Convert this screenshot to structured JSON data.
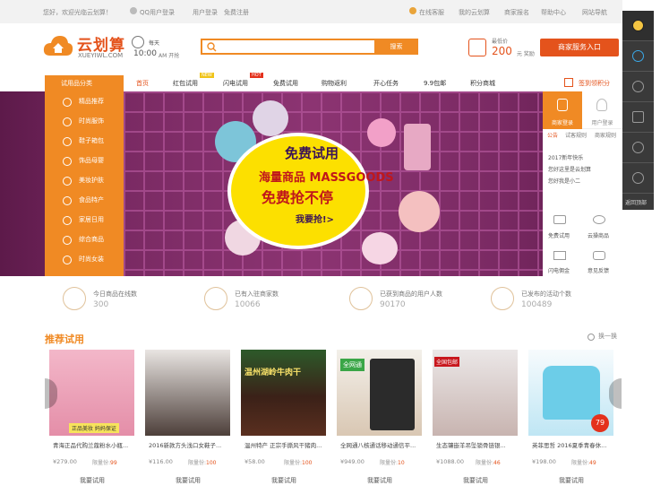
{
  "topbar": {
    "welcome": "您好，欢迎光临云划算！",
    "qq_login": "QQ用户登录",
    "login": "用户登录",
    "register": "免费注册",
    "online_service": "在线客服",
    "my_account": "我的云划算",
    "merchant_register": "商家报名",
    "help_center": "帮助中心",
    "site_nav": "网站导航"
  },
  "header": {
    "logo_text": "云划算",
    "logo_sub": "XUEYIWL.COM",
    "clock_label": "每天",
    "clock_time": "10:00",
    "clock_suffix": "AM 开抢",
    "search_placeholder": "",
    "search_button": "搜索",
    "hot_label": "最低价",
    "hot_value": "200",
    "hot_suffix": "元 奖励",
    "merchant_button": "商家服务入口"
  },
  "nav": {
    "category_head": "试用品分类",
    "items": [
      "首页",
      "红包试用",
      "闪电试用",
      "免费试用",
      "购物返利",
      "开心任务",
      "9.9包邮",
      "积分商城"
    ],
    "badge_new": "NEW",
    "badge_hot": "HOT",
    "signin": "签到领积分"
  },
  "categories": [
    "精品推荐",
    "时尚服饰",
    "鞋子箱包",
    "饰品母婴",
    "美妆护肤",
    "食品特产",
    "家居日用",
    "综合商品",
    "时尚女装"
  ],
  "banner": {
    "line1": "免费试用",
    "line2": "海量商品 MASSGOODS",
    "line3": "免费抢不停",
    "cta": "我要抢!>"
  },
  "right_panel": {
    "tab_merchant": "商家登录",
    "tab_user": "用户登录",
    "subtabs": [
      "公告",
      "试客规则",
      "商家规则"
    ],
    "news": [
      "2017新年快乐",
      "您好这里是云划算",
      "您好我是小二"
    ],
    "services": [
      "免费试用",
      "云操商品",
      "闪电佣金",
      "意见反馈"
    ]
  },
  "stats": [
    {
      "label": "今日商品在线数",
      "value": "300"
    },
    {
      "label": "已有入驻商家数",
      "value": "10066"
    },
    {
      "label": "已获到商品的用户人数",
      "value": "90170"
    },
    {
      "label": "已发布的活动个数",
      "value": "100489"
    }
  ],
  "recommend": {
    "title": "推荐试用",
    "refresh": "换一换"
  },
  "products": [
    {
      "name": "青海正品代购兰蔻粉水小瓶...",
      "price": "¥279.00",
      "qty_label": "限量份",
      "qty": "99",
      "button": "我要试用",
      "img_badge": "正品美妆 妈妈保证"
    },
    {
      "name": "2016新款方头浅口女鞋子...",
      "price": "¥116.00",
      "qty_label": "限量份",
      "qty": "100",
      "button": "我要试用",
      "img_badge": ""
    },
    {
      "name": "温州特产 正宗手撕风干猪肉...",
      "price": "¥58.00",
      "qty_label": "限量份",
      "qty": "100",
      "button": "我要试用",
      "img_badge": "温州湖岭牛肉干"
    },
    {
      "name": "全网通八核通话移动通信平...",
      "price": "¥949.00",
      "qty_label": "限量份",
      "qty": "10",
      "button": "我要试用",
      "img_badge": "全网通"
    },
    {
      "name": "生态镶嵌羊吊坠锁骨链银...",
      "price": "¥1088.00",
      "qty_label": "限量份",
      "qty": "46",
      "button": "我要试用",
      "img_badge": "全国包邮"
    },
    {
      "name": "英菲思哲 2016夏季青春休...",
      "price": "¥198.00",
      "qty_label": "限量份",
      "qty": "49",
      "button": "我要试用",
      "img_badge": "79"
    }
  ],
  "sidebar": {
    "items": [
      "qq-icon",
      "globe-icon",
      "user-icon",
      "cart-icon",
      "heart-icon",
      "chat-icon"
    ],
    "back_top": "返回顶部"
  }
}
